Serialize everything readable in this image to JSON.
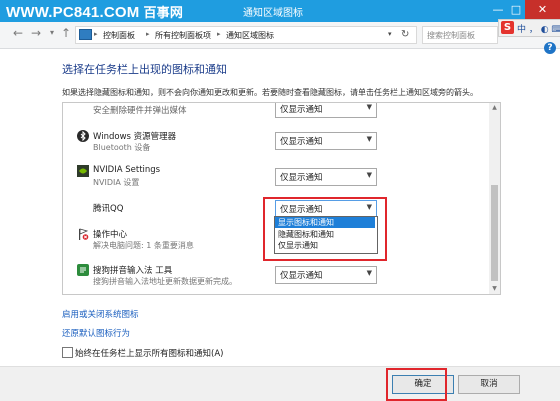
{
  "window": {
    "watermark": "WWW.PC841.COM",
    "watermark_suffix": "百事网",
    "title": "通知区域图标",
    "buttons": {
      "minimize": "—",
      "maximize": "□",
      "close": "✕"
    }
  },
  "nav": {
    "back_icon": "back-arrow-icon",
    "forward_icon": "forward-arrow-icon",
    "up_icon": "up-arrow-icon",
    "breadcrumb": [
      "控制面板",
      "所有控制面板项",
      "通知区域图标"
    ],
    "search_placeholder": "搜索控制面板"
  },
  "ime": {
    "logo": "S",
    "text": "中 ， ◐ ⌨ ✦"
  },
  "content": {
    "heading": "选择在任务栏上出现的图标和通知",
    "description": "如果选择隐藏图标和通知，则不会向你通知更改和更新。若要随时查看隐藏图标，请单击任务栏上通知区域旁的箭头。",
    "rows": [
      {
        "name": "安全删除硬件并弹出媒体",
        "subtitle": "",
        "behavior": "仅显示通知",
        "icon": "usb-eject-icon"
      },
      {
        "name": "Windows 资源管理器",
        "subtitle": "Bluetooth 设备",
        "behavior": "仅显示通知",
        "icon": "bluetooth-icon"
      },
      {
        "name": "NVIDIA Settings",
        "subtitle": "NVIDIA 设置",
        "behavior": "仅显示通知",
        "icon": "nvidia-icon"
      },
      {
        "name": "腾讯QQ",
        "subtitle": "",
        "behavior": "仅显示通知",
        "icon": "qq-icon"
      },
      {
        "name": "操作中心",
        "subtitle": "解决电脑问题: 1 条重要消息",
        "behavior": "",
        "icon": "action-center-flag-icon"
      },
      {
        "name": "搜狗拼音输入法 工具",
        "subtitle": "搜狗拼音输入法地址更新数据更新完成。",
        "behavior": "仅显示通知",
        "icon": "sogou-input-icon"
      }
    ],
    "dropdown_options": [
      "显示图标和通知",
      "隐藏图标和通知",
      "仅显示通知"
    ],
    "dropdown_highlighted": "显示图标和通知"
  },
  "links": {
    "system_icons": "启用或关闭系统图标",
    "restore": "还原默认图标行为"
  },
  "checkbox": {
    "label": "始终在任务栏上显示所有图标和通知(A)",
    "checked": false
  },
  "footer": {
    "ok": "确定",
    "cancel": "取消"
  },
  "colors": {
    "titlebar": "#1f9de0",
    "highlight_box": "#e0262c",
    "selection": "#1e7fd8",
    "link": "#1b5fbf"
  }
}
